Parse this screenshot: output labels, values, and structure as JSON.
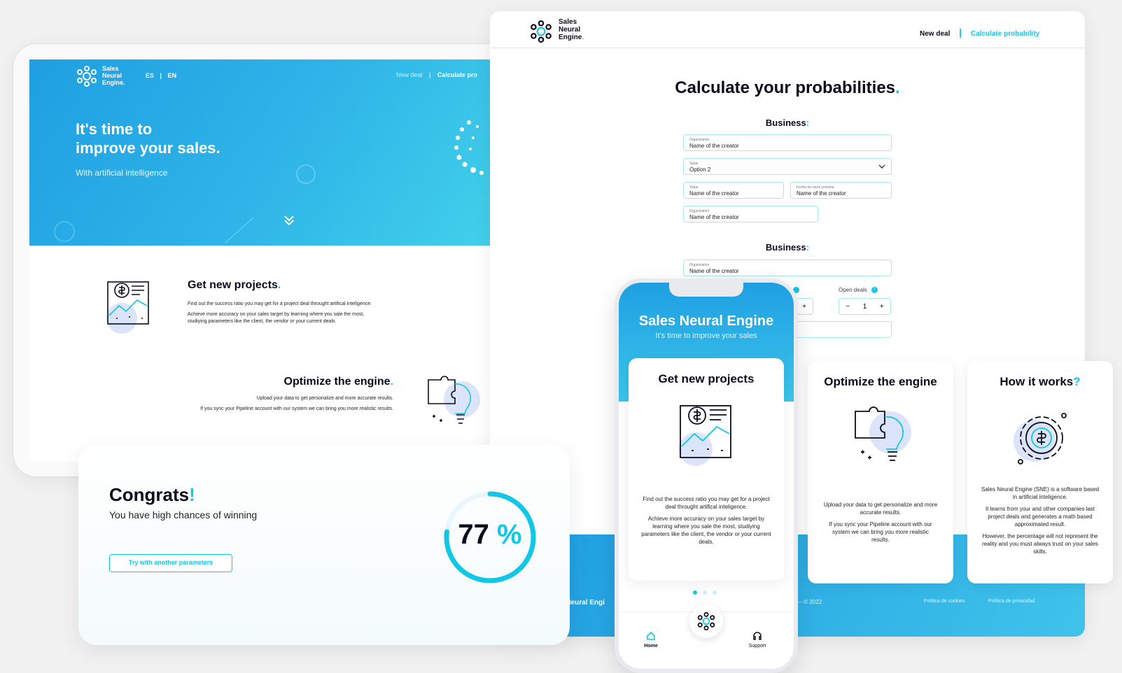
{
  "brand": {
    "name_line1": "Sales",
    "name_line2": "Neural",
    "name_line3": "Engine",
    "dot": "."
  },
  "colors": {
    "accent": "#12c6e6",
    "primary_blue": "#1f9fe2",
    "dark_text": "#0b0b1e"
  },
  "tablet": {
    "lang_es": "ES",
    "lang_sep": "|",
    "lang_en": "EN",
    "nav_new_deal": "New deal",
    "nav_calculate": "Calculate pro",
    "hero_title_1": "It's time to",
    "hero_title_2": "improve your sales.",
    "hero_subtitle": "With artificial intelligence",
    "feature1_title": "Get new projects",
    "feature1_line1": "Find out the success ratio you may get for a project deal throught artifical inteligence.",
    "feature1_line2": "Achieve more accuracy on your sales target by learning where you sale the most,",
    "feature1_line3": "studiying parameters like the client, the vendor or your current deals.",
    "feature2_title": "Optimize the engine",
    "feature2_line1": "Upload your data to get personalize and more accurate results.",
    "feature2_line2": "If you sync your Pipeline account with our system we can bring you more realistic results."
  },
  "congrats": {
    "title": "Congrats",
    "excl": "!",
    "subtitle": "You have high chances of winning",
    "button": "Try with another parameters",
    "percent_value": "77",
    "percent_sign": "%",
    "progress": 0.77
  },
  "desktop": {
    "nav_new_deal": "New deal",
    "nav_calculate": "Calculate probability",
    "title": "Calculate your probabilities",
    "section1_title": "Business",
    "section2_title": "Business",
    "colon": ":",
    "fields": {
      "f1_label": "Organization",
      "f1_value": "Name of the creator",
      "f2_label": "Value",
      "f2_value": "Option 2",
      "f3_label": "Value",
      "f3_value": "Name of the creator",
      "f4_label": "Fecha de cierre prevista",
      "f4_value": "Name of the creator",
      "f5_label": "Organization",
      "f5_value": "Name of the creator",
      "f6_label": "Organization",
      "f6_value": "Name of the creator"
    },
    "open_deals_label": "Open deals",
    "stepper_value": "1",
    "footer_brand": "s Neural Engi",
    "footer_copyright": "— © 2022",
    "footer_cookies": "Política de cookies",
    "footer_privacy": "Política de privacidad"
  },
  "phone": {
    "title": "Sales Neural Engine",
    "subtitle": "It's time to improve your sales",
    "card_title": "Get new projects",
    "card_text1": "Find out the success ratio you may get for a project deal throught artifical inteligence.",
    "card_text2": "Achieve more accuracy on your sales target by learning where you sale the most, studiying parameters like the client, the vendor or your current deals.",
    "tab_home": "Home",
    "tab_support": "Support"
  },
  "cards": {
    "optimize_title": "Optimize the engine",
    "optimize_text1": "Upload your data to get personalize and more accurate results.",
    "optimize_text2": "If you sync your Pipeline account with our system we can bring you more realistic results.",
    "how_title": "How it works",
    "how_q": "?",
    "how_text1": "Sales Neural Engine (SNE) is a software based in artificial inteligence.",
    "how_text2": "It learns from your and other companies last project deals and generates a math based approximated result.",
    "how_text3": "However, the percentage will not represent the reality and you must always trust on your sales skills."
  }
}
